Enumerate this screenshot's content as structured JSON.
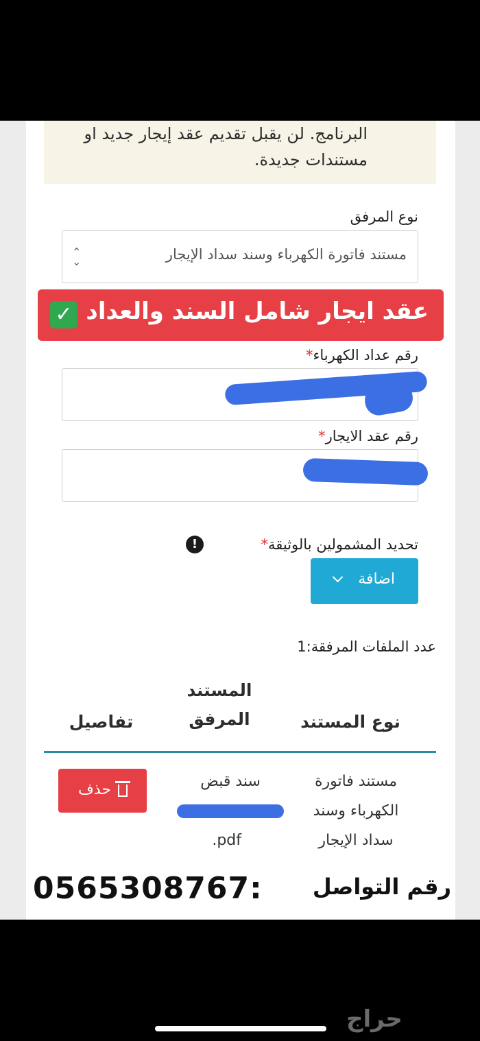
{
  "notice": {
    "text": "البرنامج. لن يقبل تقديم عقد إيجار جديد او مستندات جديدة."
  },
  "attachment_type": {
    "label": "نوع المرفق",
    "selected": "مستند فاتورة الكهرباء وسند سداد الإيجار"
  },
  "banner": {
    "text": "عقد ايجار شامل السند والعداد"
  },
  "meter_number": {
    "label": "رقم عداد الكهرباء",
    "required_mark": "*"
  },
  "lease_number": {
    "label": "رقم عقد الايجار",
    "required_mark": "*"
  },
  "beneficiaries": {
    "label": "تحديد المشمولين بالوثيقة",
    "required_mark": "*",
    "info_glyph": "!",
    "add_button": "اضافة"
  },
  "files_count": {
    "text": "عدد الملفات المرفقة:1"
  },
  "table": {
    "headers": [
      "نوع المستند",
      "المستند المرفق",
      "تفاصيل"
    ],
    "rows": [
      {
        "doc_type": "مستند فاتورة الكهرباء وسند سداد الإيجار",
        "attached_doc": "سند قبض",
        "attached_ext": ".pdf",
        "delete_label": "حذف"
      }
    ]
  },
  "contact": {
    "label": "رقم التواصل",
    "number": "0565308767:"
  },
  "watermark": {
    "text": "حراج"
  },
  "colors": {
    "banner": "#e63f45",
    "add_button": "#21a9d6",
    "table_rule": "#2b8ca5",
    "redaction": "#3b6fe3"
  }
}
